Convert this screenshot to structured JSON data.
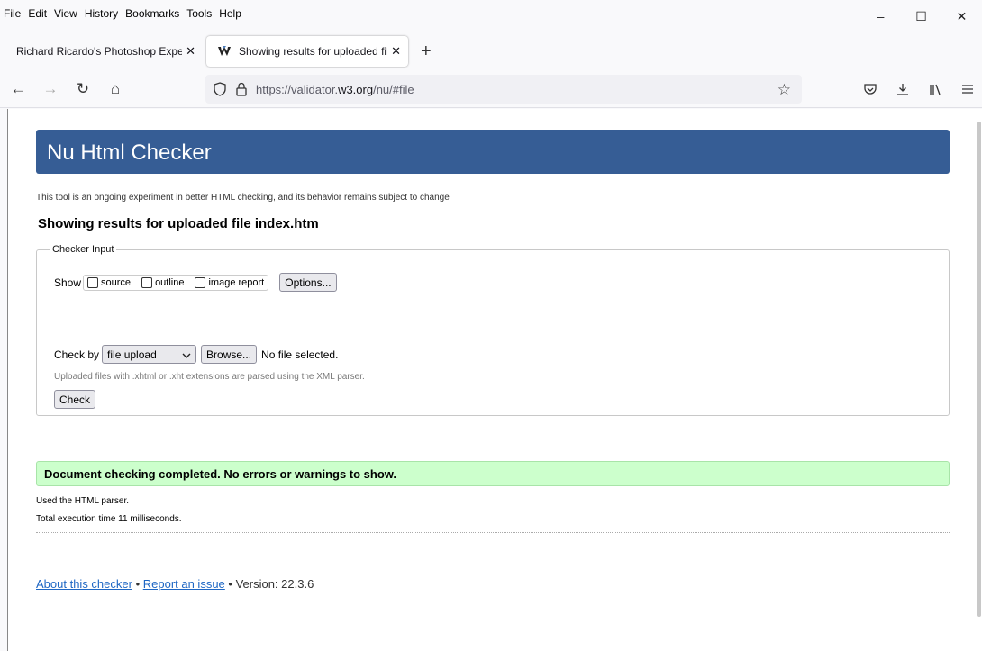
{
  "menubar": {
    "items": [
      "File",
      "Edit",
      "View",
      "History",
      "Bookmarks",
      "Tools",
      "Help"
    ]
  },
  "window_controls": {
    "minimize": "–",
    "maximize": "☐",
    "close": "✕"
  },
  "tabs": [
    {
      "title": "Richard Ricardo's Photoshop Experi",
      "close": "✕",
      "active": false
    },
    {
      "title": "Showing results for uploaded fil",
      "close": "✕",
      "active": true
    }
  ],
  "new_tab": "+",
  "nav": {
    "back": "←",
    "forward": "→",
    "reload": "↻",
    "home": "⌂",
    "url_prefix": "https://validator.",
    "url_host": "w3.org",
    "url_suffix": "/nu/#file",
    "star": "☆"
  },
  "toolbar_icons": [
    "pocket-icon",
    "download-icon",
    "library-icon",
    "menu-icon"
  ],
  "page": {
    "header": "Nu Html Checker",
    "intro": "This tool is an ongoing experiment in better HTML checking, and its behavior remains subject to change",
    "result_title": "Showing results for uploaded file index.htm",
    "checker": {
      "legend": "Checker Input",
      "show_label": "Show",
      "show_options": [
        "source",
        "outline",
        "image report"
      ],
      "options_button": "Options...",
      "check_by_label": "Check by",
      "check_by_value": "file upload",
      "browse_button": "Browse...",
      "no_file": "No file selected.",
      "note": "Uploaded files with .xhtml or .xht extensions are parsed using the XML parser.",
      "check_button": "Check"
    },
    "success": "Document checking completed. No errors or warnings to show.",
    "parser_note": "Used the HTML parser.",
    "exec_note": "Total execution time 11 milliseconds.",
    "footer": {
      "about": "About this checker",
      "sep1": " • ",
      "report": "Report an issue",
      "version": " • Version: 22.3.6"
    }
  },
  "colors": {
    "header_bg": "#365d95",
    "success_bg": "#ccffcc",
    "link": "#1f67c4"
  }
}
